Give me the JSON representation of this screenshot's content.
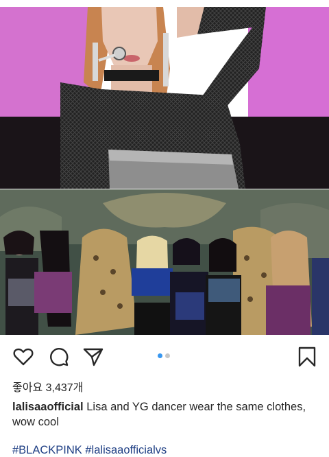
{
  "post": {
    "images": [
      {
        "icon": "concert-performer-photo"
      },
      {
        "icon": "dancers-group-photo"
      }
    ],
    "actions": {
      "like_icon": "heart-outline-icon",
      "comment_icon": "comment-bubble-icon",
      "share_icon": "paper-plane-icon",
      "save_icon": "bookmark-icon"
    },
    "carousel": {
      "total": 2,
      "active": 1,
      "active_color": "#3897f0",
      "inactive_color": "#c7c7c7"
    },
    "likes_text": "좋아요 3,437개",
    "caption": {
      "username": "lalisaaofficial",
      "text": "Lisa and YG dancer wear the same clothes, wow cool"
    },
    "hashtags": "#BLACKPINK #lalisaaofficialvs",
    "colors": {
      "text": "#262626",
      "hashtag": "#1f3f84"
    }
  }
}
